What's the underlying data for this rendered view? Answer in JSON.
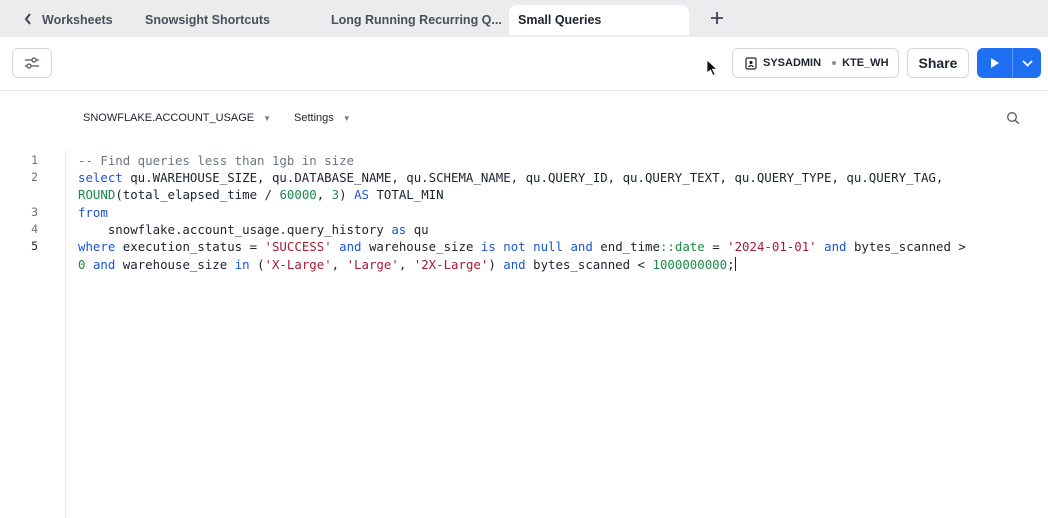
{
  "tabs": {
    "back_label": "Worksheets",
    "items": [
      "Snowsight Shortcuts",
      "Long Running Recurring Q...",
      "Small Queries"
    ],
    "active_index": 2,
    "new_tab_label": "+"
  },
  "toolbar": {
    "role": "SYSADMIN",
    "warehouse": "KTE_WH",
    "share_label": "Share"
  },
  "context": {
    "database": "SNOWFLAKE.ACCOUNT_USAGE",
    "settings_label": "Settings"
  },
  "editor": {
    "line_numbers": [
      "1",
      "2",
      "3",
      "4",
      "5"
    ],
    "current_line": 5,
    "lines": [
      "-- Find queries less than 1gb in size",
      "select qu.WAREHOUSE_SIZE, qu.DATABASE_NAME, qu.SCHEMA_NAME, qu.QUERY_ID, qu.QUERY_TEXT, qu.QUERY_TYPE, qu.QUERY_TAG,",
      "ROUND(total_elapsed_time / 60000, 3) AS TOTAL_MIN",
      "from",
      "    snowflake.account_usage.query_history as qu",
      "where execution_status = 'SUCCESS' and warehouse_size is not null and end_time::date = '2024-01-01' and bytes_scanned >",
      "0 and warehouse_size in ('X-Large', 'Large', '2X-Large') and bytes_scanned < 1000000000;"
    ]
  },
  "icons": [
    "chevron-left-icon",
    "plus-icon",
    "filter-sliders-icon",
    "role-badge-icon",
    "play-icon",
    "chevron-down-icon",
    "search-icon",
    "mouse-pointer-icon"
  ],
  "colors": {
    "accent": "#1f6ff2",
    "keyword": "#1d55d4",
    "string": "#a31c34",
    "number": "#1b8a4a"
  }
}
